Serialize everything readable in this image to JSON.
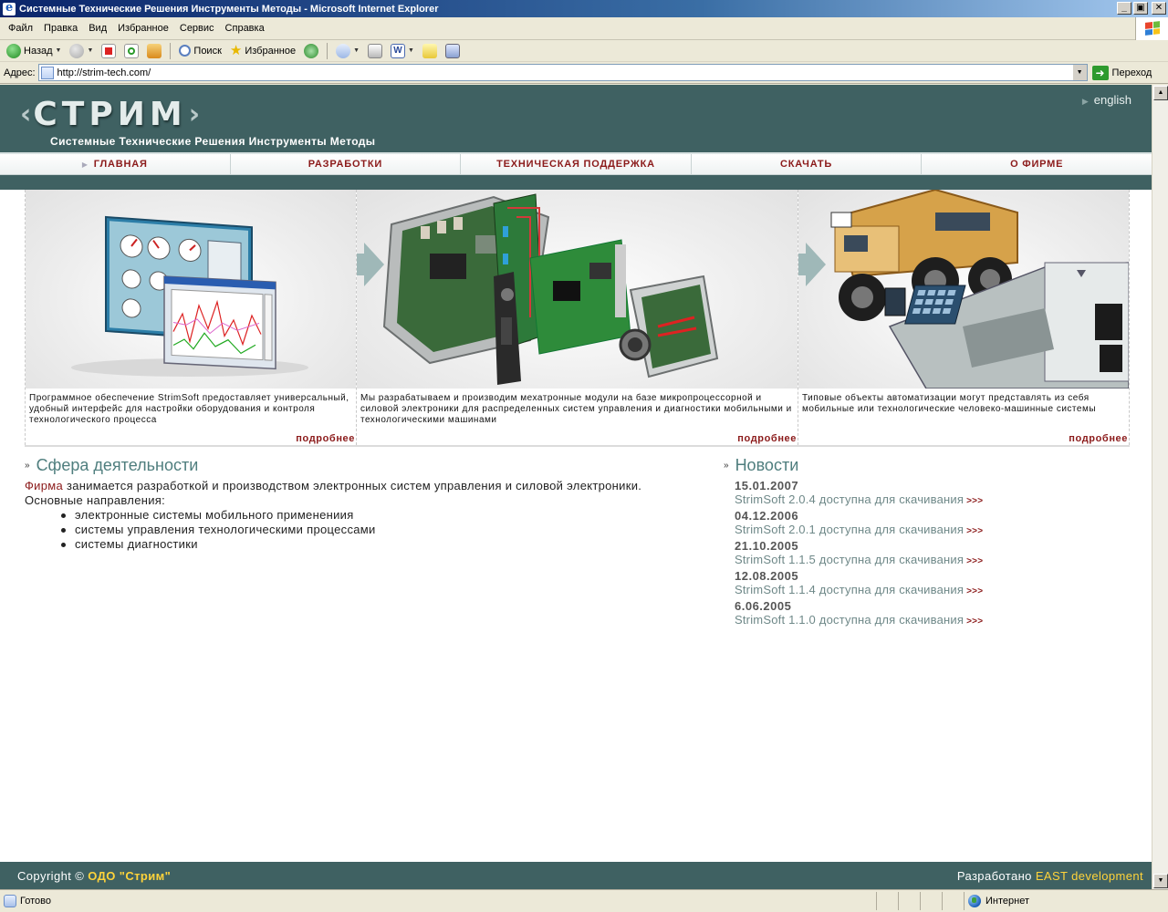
{
  "window": {
    "title": "Системные Технические Решения Инструменты Методы - Microsoft Internet Explorer",
    "controls": {
      "minimize": "_",
      "maximize": "▣",
      "close": "✕"
    }
  },
  "menu": [
    "Файл",
    "Правка",
    "Вид",
    "Избранное",
    "Сервис",
    "Справка"
  ],
  "toolbar": {
    "back_label": "Назад",
    "search_label": "Поиск",
    "favorites_label": "Избранное"
  },
  "address": {
    "label": "Адрес:",
    "value": "http://strim-tech.com/",
    "go_label": "Переход"
  },
  "site": {
    "logo": "СТРИМ",
    "logo_left_chevron": "‹",
    "logo_right_chevron": "›",
    "tagline": "Системные Технические Решения Инструменты Методы",
    "language_link": "english",
    "nav": [
      "ГЛАВНАЯ",
      "РАЗРАБОТКИ",
      "ТЕХНИЧЕСКАЯ ПОДДЕРЖКА",
      "СКАЧАТЬ",
      "О ФИРМЕ"
    ],
    "nav_active_index": 0,
    "banner": [
      {
        "desc": "Программное обеспечение StrimSoft предоставляет универсальный, удобный интерфейс для настройки оборудования и контроля технологического процесса",
        "more": "подробнее"
      },
      {
        "desc": "Мы разрабатываем и производим мехатронные модули на базе микропроцессорной и силовой электроники для распределенных систем управления и диагностики мобильными и технологическими машинами",
        "more": "подробнее"
      },
      {
        "desc": "Типовые объекты автоматизации могут представлять из себя мобильные или технологические человеко-машинные системы",
        "more": "подробнее"
      }
    ],
    "activity": {
      "title": "Сфера деятельности",
      "firm_link": "Фирма",
      "intro_rest": " занимается разработкой и производством электронных систем управления и силовой электроники.",
      "directions_label": "Основные направления:",
      "items": [
        "электронные системы мобильного применениия",
        "системы управления технологическими процессами",
        "системы диагностики"
      ]
    },
    "news": {
      "title": "Новости",
      "items": [
        {
          "date": "15.01.2007",
          "text": "StrimSoft 2.0.4 доступна для скачивания",
          "more": ">>>"
        },
        {
          "date": "04.12.2006",
          "text": "StrimSoft 2.0.1 доступна для скачивания",
          "more": ">>>"
        },
        {
          "date": "21.10.2005",
          "text": "StrimSoft 1.1.5 доступна для скачивания",
          "more": ">>>"
        },
        {
          "date": "12.08.2005",
          "text": "StrimSoft 1.1.4 доступна для скачивания",
          "more": ">>>"
        },
        {
          "date": "6.06.2005",
          "text": "StrimSoft 1.1.0 доступна для скачивания",
          "more": ">>>"
        }
      ]
    },
    "footer": {
      "copyright_prefix": "Copyright ©",
      "company": "ОДО \"Стрим\"",
      "developed_prefix": "Разработано",
      "developer": "EAST development"
    }
  },
  "status": {
    "text": "Готово",
    "zone": "Интернет"
  },
  "colors": {
    "site_dark_teal": "#3f6162",
    "nav_text": "#8b1a1a",
    "section_title": "#4f7e7e",
    "footer_highlight": "#ffd33a"
  }
}
